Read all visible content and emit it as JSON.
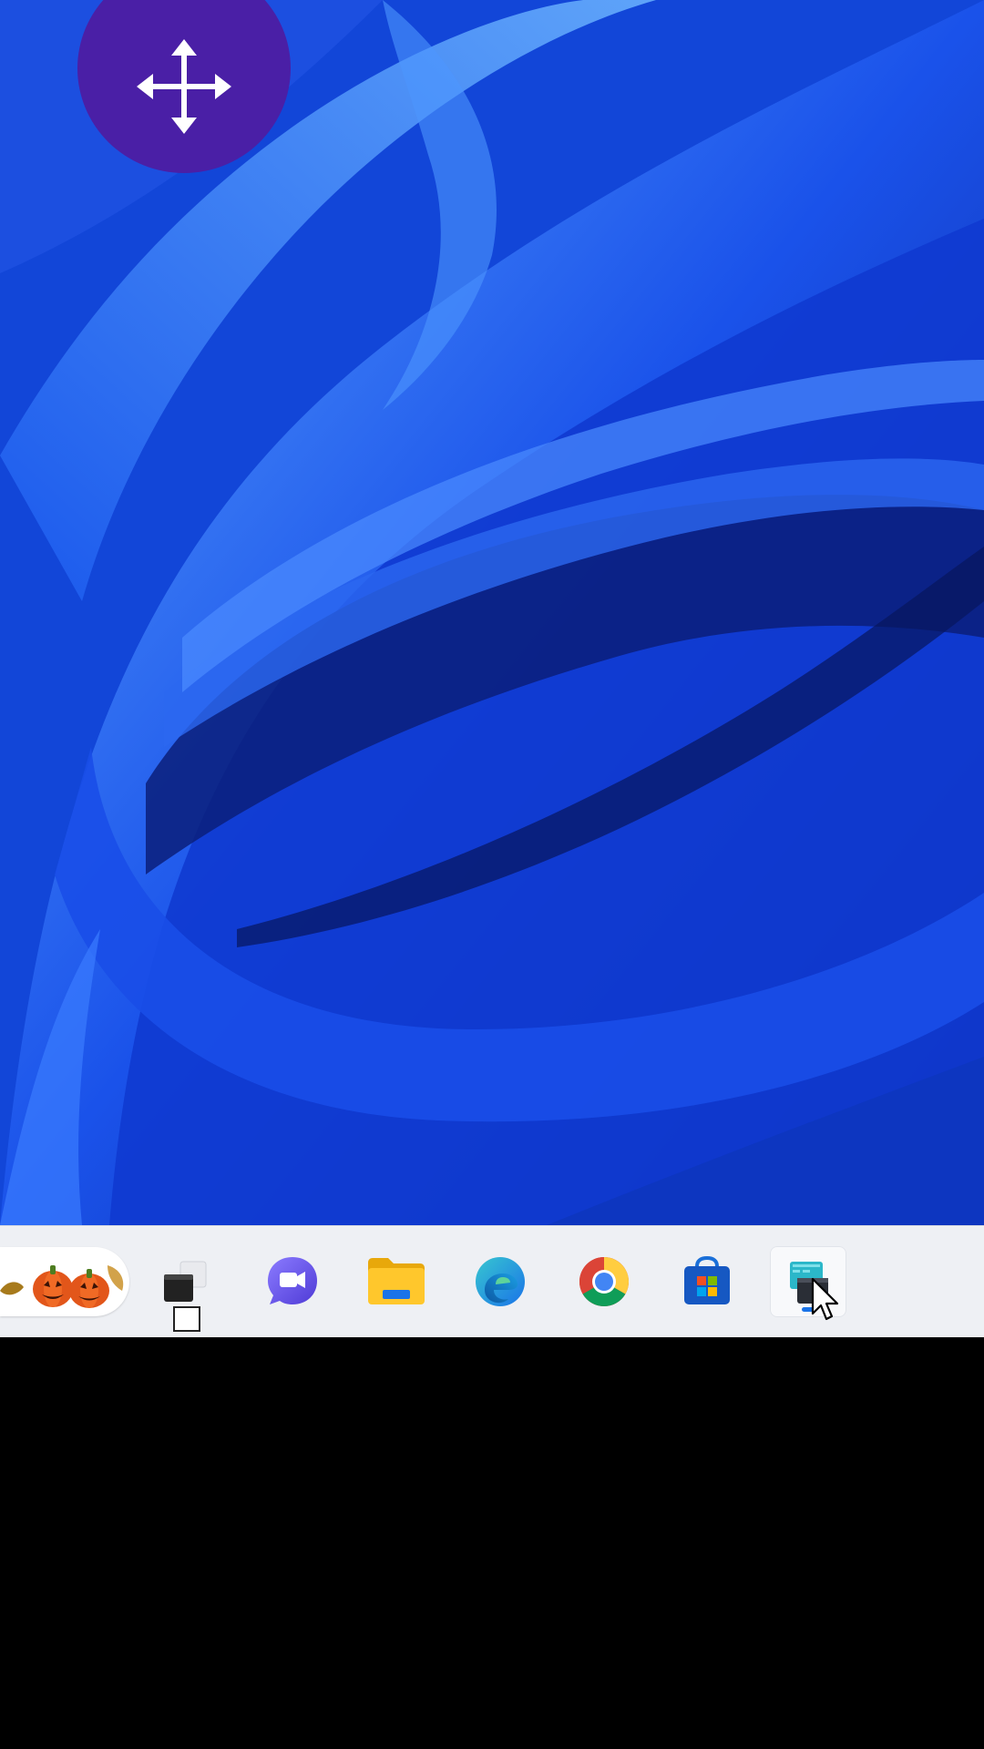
{
  "screen": {
    "desktop": {
      "wallpaper": "windows-11-bloom-blue",
      "move_handle_icon": "move-arrows-icon"
    },
    "taskbar": {
      "items": [
        {
          "name": "widgets",
          "icon": "halloween-pumpkins-icon"
        },
        {
          "name": "task-view",
          "icon": "task-view-icon"
        },
        {
          "name": "chat",
          "icon": "teams-chat-icon"
        },
        {
          "name": "file-explorer",
          "icon": "folder-icon"
        },
        {
          "name": "edge",
          "icon": "edge-icon"
        },
        {
          "name": "chrome",
          "icon": "chrome-icon"
        },
        {
          "name": "microsoft-store",
          "icon": "store-icon"
        },
        {
          "name": "active-app",
          "icon": "app-window-icon",
          "active": true
        }
      ]
    },
    "colors": {
      "accent": "#1a73e8",
      "move_handle": "#4a1fa6",
      "taskbar_bg": "#eef0f4"
    }
  }
}
